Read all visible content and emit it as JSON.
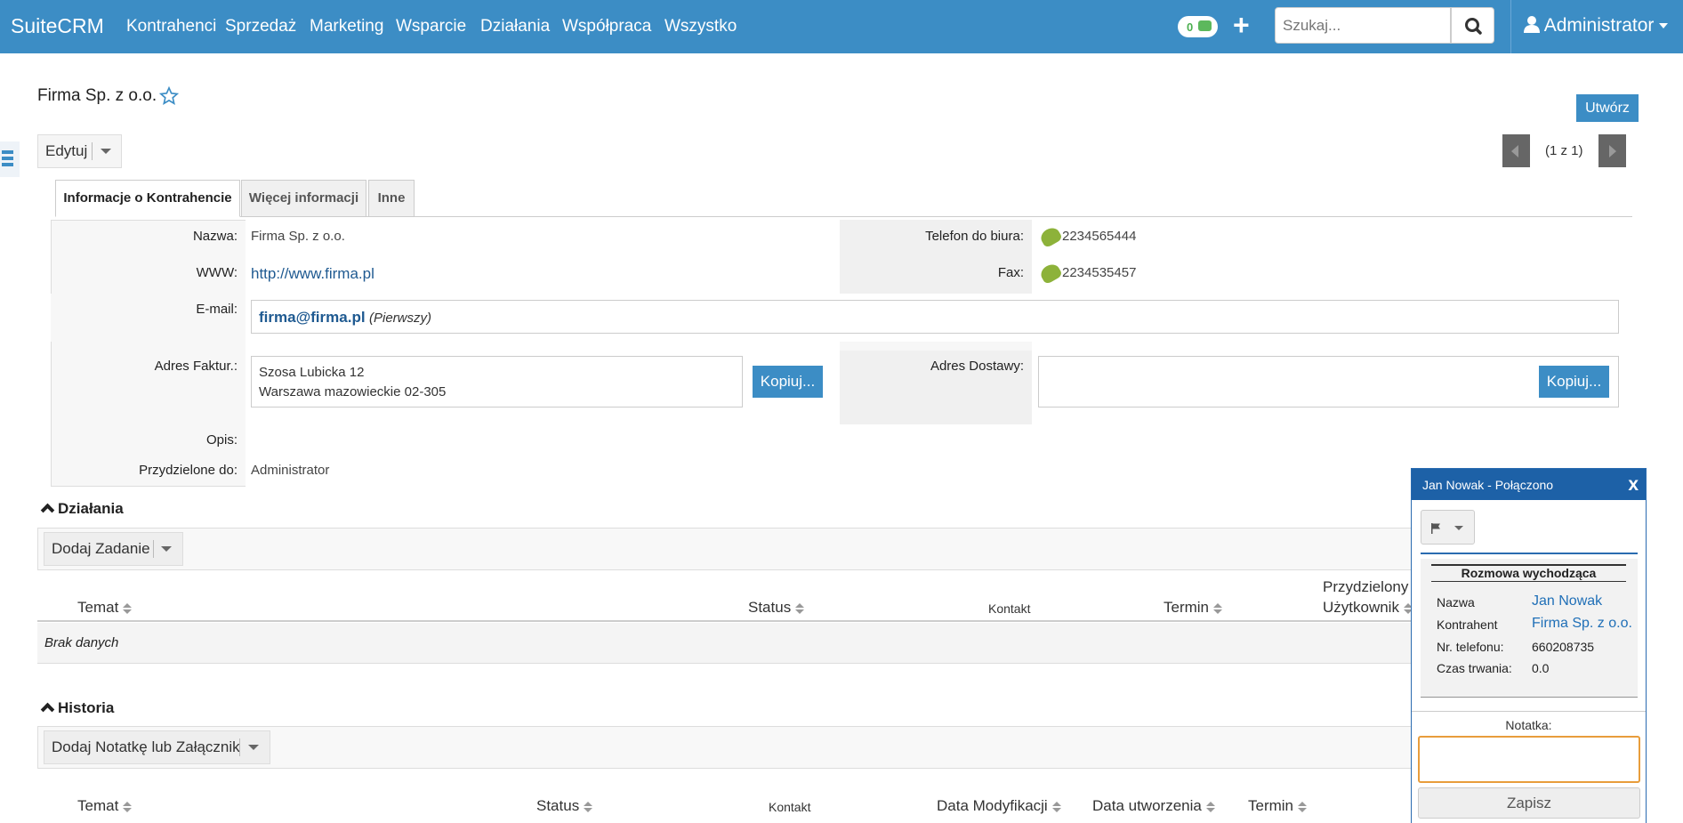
{
  "navbar": {
    "brand": "SuiteCRM",
    "items": [
      "Kontrahenci",
      "Sprzedaż",
      "Marketing",
      "Wsparcie",
      "Działania",
      "Współpraca",
      "Wszystko"
    ],
    "notification_count": "0",
    "plus": "+",
    "search_placeholder": "Szukaj...",
    "user": "Administrator"
  },
  "record": {
    "title": "Firma Sp. z o.o.",
    "create_button": "Utwórz",
    "edit_button": "Edytuj",
    "pagination": "(1 z 1)"
  },
  "tabs": [
    "Informacje o Kontrahencie",
    "Więcej informacji",
    "Inne"
  ],
  "detail": {
    "name_label": "Nazwa:",
    "name_value": "Firma Sp. z o.o.",
    "www_label": "WWW:",
    "www_value": "http://www.firma.pl",
    "email_label": "E-mail:",
    "email_value": "firma@firma.pl",
    "email_primary": "(Pierwszy)",
    "billing_label": "Adres Faktur.:",
    "billing_line1": "Szosa Lubicka 12",
    "billing_line2": "Warszawa mazowieckie  02-305",
    "copy_button": "Kopiuj...",
    "description_label": "Opis:",
    "assigned_label": "Przydzielone do:",
    "assigned_value": "Administrator",
    "office_phone_label": "Telefon do biura:",
    "office_phone_value": "2234565444",
    "fax_label": "Fax:",
    "fax_value": "2234535457",
    "shipping_label": "Adres Dostawy:"
  },
  "activities": {
    "title": "Działania",
    "add_button": "Dodaj Zadanie",
    "columns": [
      "Temat",
      "Status",
      "Kontakt",
      "Termin",
      "Przydzielony",
      "Użytkownik"
    ],
    "empty": "Brak danych"
  },
  "history": {
    "title": "Historia",
    "add_button": "Dodaj Notatkę lub Załącznik",
    "columns": [
      "Temat",
      "Status",
      "Kontakt",
      "Data Modyfikacji",
      "Data utworzenia",
      "Termin"
    ]
  },
  "call_popup": {
    "header": "Jan Nowak - Połączono",
    "close": "x",
    "section_title": "Rozmowa wychodząca",
    "name_label": "Nazwa",
    "name_value": "Jan Nowak",
    "account_label": "Kontrahent",
    "account_value": "Firma Sp. z o.o.",
    "phone_label": "Nr. telefonu:",
    "phone_value": "660208735",
    "duration_label": "Czas trwania:",
    "duration_value": "0.0",
    "note_label": "Notatka:",
    "save_button": "Zapisz"
  },
  "colors": {
    "primary": "#3c8dc5",
    "popup_header": "#1d61a7",
    "link": "#1f5a91"
  }
}
